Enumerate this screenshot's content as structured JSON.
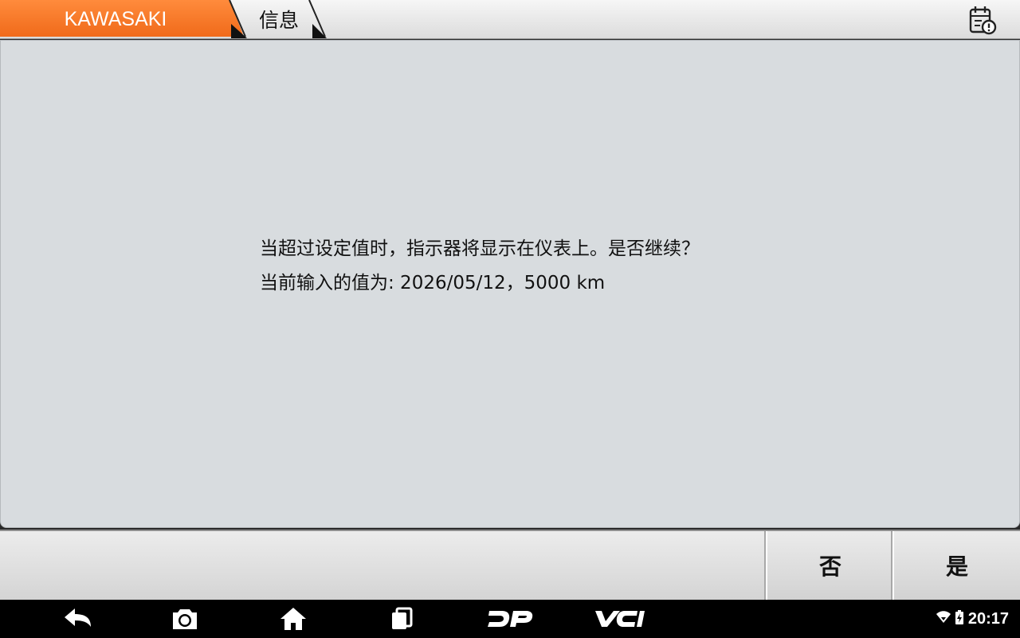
{
  "header": {
    "brand": "KAWASAKI",
    "section": "信息",
    "brand_color": "#f47a2c",
    "icon": "report-calendar-icon"
  },
  "message": {
    "line1": "当超过设定值时，指示器将显示在仪表上。是否继续？",
    "line2": "当前输入的值为: 2026/05/12，5000 km"
  },
  "actions": {
    "no_label": "否",
    "yes_label": "是"
  },
  "navbar": {
    "icons": [
      "back-icon",
      "camera-icon",
      "home-icon",
      "recent-apps-icon",
      "dp-logo-icon",
      "vci-logo-icon"
    ],
    "dp_text": "DP",
    "vci_text": "VCI"
  },
  "statusbar": {
    "time": "20:17",
    "icons": [
      "wifi-icon",
      "battery-charging-icon"
    ]
  }
}
